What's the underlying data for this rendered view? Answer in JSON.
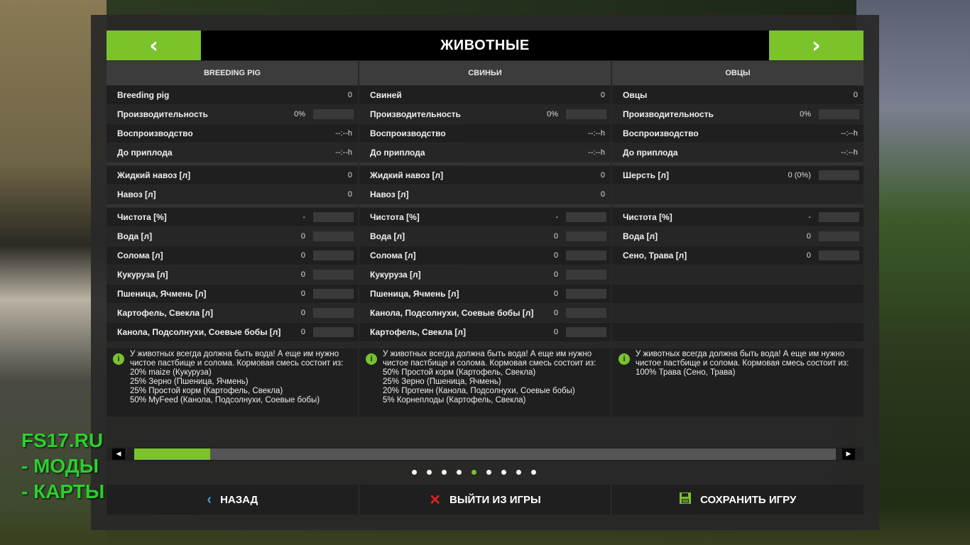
{
  "header": {
    "title": "ЖИВОТНЫЕ",
    "prev_glyph": "‹",
    "next_glyph": "›"
  },
  "columns": [
    {
      "name": "BREEDING PIG",
      "stats": [
        {
          "label": "Breeding pig",
          "value": "0"
        },
        {
          "label": "Производительность",
          "value": "0%"
        },
        {
          "label": "Воспроизводство",
          "value": "--:--h"
        },
        {
          "label": "До приплода",
          "value": "--:--h"
        }
      ],
      "products": [
        {
          "label": "Жидкий навоз [л]",
          "value": "0"
        },
        {
          "label": "Навоз [л]",
          "value": "0"
        }
      ],
      "needs": [
        {
          "label": "Чистота [%]",
          "value": "-"
        },
        {
          "label": "Вода [л]",
          "value": "0"
        },
        {
          "label": "Солома [л]",
          "value": "0"
        },
        {
          "label": "Кукуруза [л]",
          "value": "0"
        },
        {
          "label": "Пшеница, Ячмень [л]",
          "value": "0"
        },
        {
          "label": "Картофель, Свекла [л]",
          "value": "0"
        },
        {
          "label": "Канола, Подсолнухи, Соевые бобы [л]",
          "value": "0"
        }
      ],
      "info": "У животных всегда должна быть вода! А еще им нужно чистое пастбище и солома. Кормовая смесь состоит из:\n20% maize (Кукуруза)\n25% Зерно (Пшеница, Ячмень)\n25% Простой корм (Картофель, Свекла)\n50% MyFeed (Канола, Подсолнухи, Соевые бобы)"
    },
    {
      "name": "СВИНЬИ",
      "stats": [
        {
          "label": "Свиней",
          "value": "0"
        },
        {
          "label": "Производительность",
          "value": "0%"
        },
        {
          "label": "Воспроизводство",
          "value": "--:--h"
        },
        {
          "label": "До приплода",
          "value": "--:--h"
        }
      ],
      "products": [
        {
          "label": "Жидкий навоз [л]",
          "value": "0"
        },
        {
          "label": "Навоз [л]",
          "value": "0"
        }
      ],
      "needs": [
        {
          "label": "Чистота [%]",
          "value": "-"
        },
        {
          "label": "Вода [л]",
          "value": "0"
        },
        {
          "label": "Солома [л]",
          "value": "0"
        },
        {
          "label": "Кукуруза [л]",
          "value": "0"
        },
        {
          "label": "Пшеница, Ячмень [л]",
          "value": "0"
        },
        {
          "label": "Канола, Подсолнухи, Соевые бобы [л]",
          "value": "0"
        },
        {
          "label": "Картофель, Свекла [л]",
          "value": "0"
        }
      ],
      "info": "У животных всегда должна быть вода! А еще им нужно чистое пастбище и солома. Кормовая смесь состоит из:\n50% Простой корм (Картофель, Свекла)\n25% Зерно (Пшеница, Ячмень)\n20% Протеин (Канола, Подсолнухи, Соевые бобы)\n5% Корнеплоды (Картофель, Свекла)"
    },
    {
      "name": "ОВЦЫ",
      "stats": [
        {
          "label": "Овцы",
          "value": "0"
        },
        {
          "label": "Производительность",
          "value": "0%"
        },
        {
          "label": "Воспроизводство",
          "value": "--:--h"
        },
        {
          "label": "До приплода",
          "value": "--:--h"
        }
      ],
      "products": [
        {
          "label": "Шерсть [л]",
          "value": "0 (0%)"
        },
        {
          "label": "",
          "value": ""
        }
      ],
      "needs": [
        {
          "label": "Чистота [%]",
          "value": "-"
        },
        {
          "label": "Вода [л]",
          "value": "0"
        },
        {
          "label": "Сено, Трава [л]",
          "value": "0"
        },
        {
          "label": "",
          "value": ""
        },
        {
          "label": "",
          "value": ""
        },
        {
          "label": "",
          "value": ""
        },
        {
          "label": "",
          "value": ""
        }
      ],
      "info": "У животных всегда должна быть вода! А еще им нужно чистое пастбище и солома. Кормовая смесь состоит из:\n100% Трава (Сено, Трава)"
    }
  ],
  "pagination": {
    "count": 9,
    "active": 4
  },
  "scrollbar": {
    "position": 0.11
  },
  "footer": {
    "back": "НАЗАД",
    "quit": "ВЫЙТИ ИЗ ИГРЫ",
    "save": "СОХРАНИТЬ ИГРУ"
  },
  "watermark": {
    "line1": "FS17.RU",
    "line2": "- МОДЫ",
    "line3": "- КАРТЫ"
  },
  "colors": {
    "accent": "#7ac32b",
    "quit": "#e02020",
    "back": "#3aa0e0",
    "save": "#7ac32b"
  }
}
